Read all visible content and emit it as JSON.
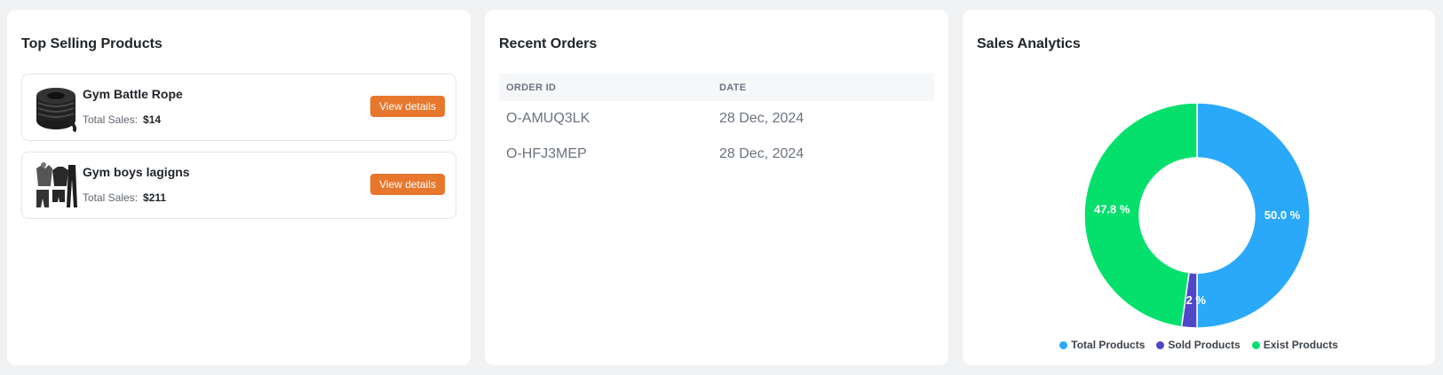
{
  "top_selling": {
    "title": "Top Selling Products",
    "products": [
      {
        "name": "Gym Battle Rope",
        "sales_label": "Total Sales:",
        "sales_value": "$14",
        "button_label": "View details",
        "thumb_icon": "battle-rope-image"
      },
      {
        "name": "Gym boys lagigns",
        "sales_label": "Total Sales:",
        "sales_value": "$211",
        "button_label": "View details",
        "thumb_icon": "gym-clothing-set-image"
      }
    ]
  },
  "recent_orders": {
    "title": "Recent Orders",
    "columns": [
      "ORDER ID",
      "DATE"
    ],
    "rows": [
      {
        "order_id": "O-AMUQ3LK",
        "date": "28 Dec, 2024"
      },
      {
        "order_id": "O-HFJ3MEP",
        "date": "28 Dec, 2024"
      }
    ]
  },
  "sales_analytics": {
    "title": "Sales Analytics",
    "chart_data": {
      "type": "pie",
      "series": [
        {
          "name": "Total Products",
          "value": 50.0,
          "label": "50.0 %",
          "color": "#2aa9fb"
        },
        {
          "name": "Sold Products",
          "value": 2.2,
          "label": "2.2 %",
          "color": "#5046c8"
        },
        {
          "name": "Exist Products",
          "value": 47.8,
          "label": "47.8 %",
          "color": "#05e06d"
        }
      ],
      "legend_position": "bottom"
    }
  },
  "colors": {
    "accent_button": "#e8772e",
    "page_bg": "#f1f2f4"
  }
}
